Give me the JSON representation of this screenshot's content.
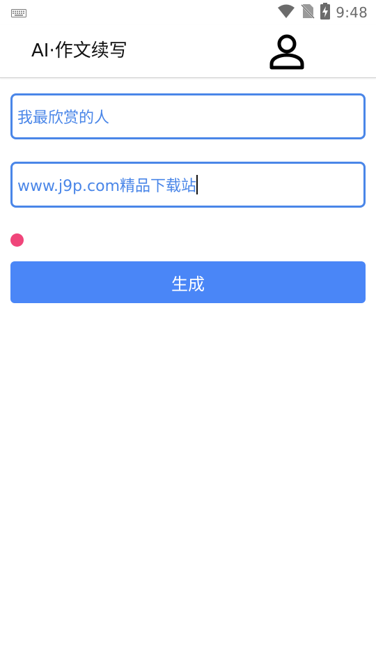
{
  "status_bar": {
    "time": "9:48",
    "icons": [
      "keyboard-icon",
      "wifi-icon",
      "no-sim-icon",
      "battery-charging-icon"
    ]
  },
  "app_bar": {
    "title": "AI·作文续写",
    "user_icon": "user-icon"
  },
  "form": {
    "topic_value": "我最欣赏的人",
    "second_value": "www.j9p.com精品下载站",
    "generate_label": "生成"
  },
  "colors": {
    "accent": "#4a86e8",
    "button": "#4a86f7",
    "dot": "#f0457a"
  }
}
